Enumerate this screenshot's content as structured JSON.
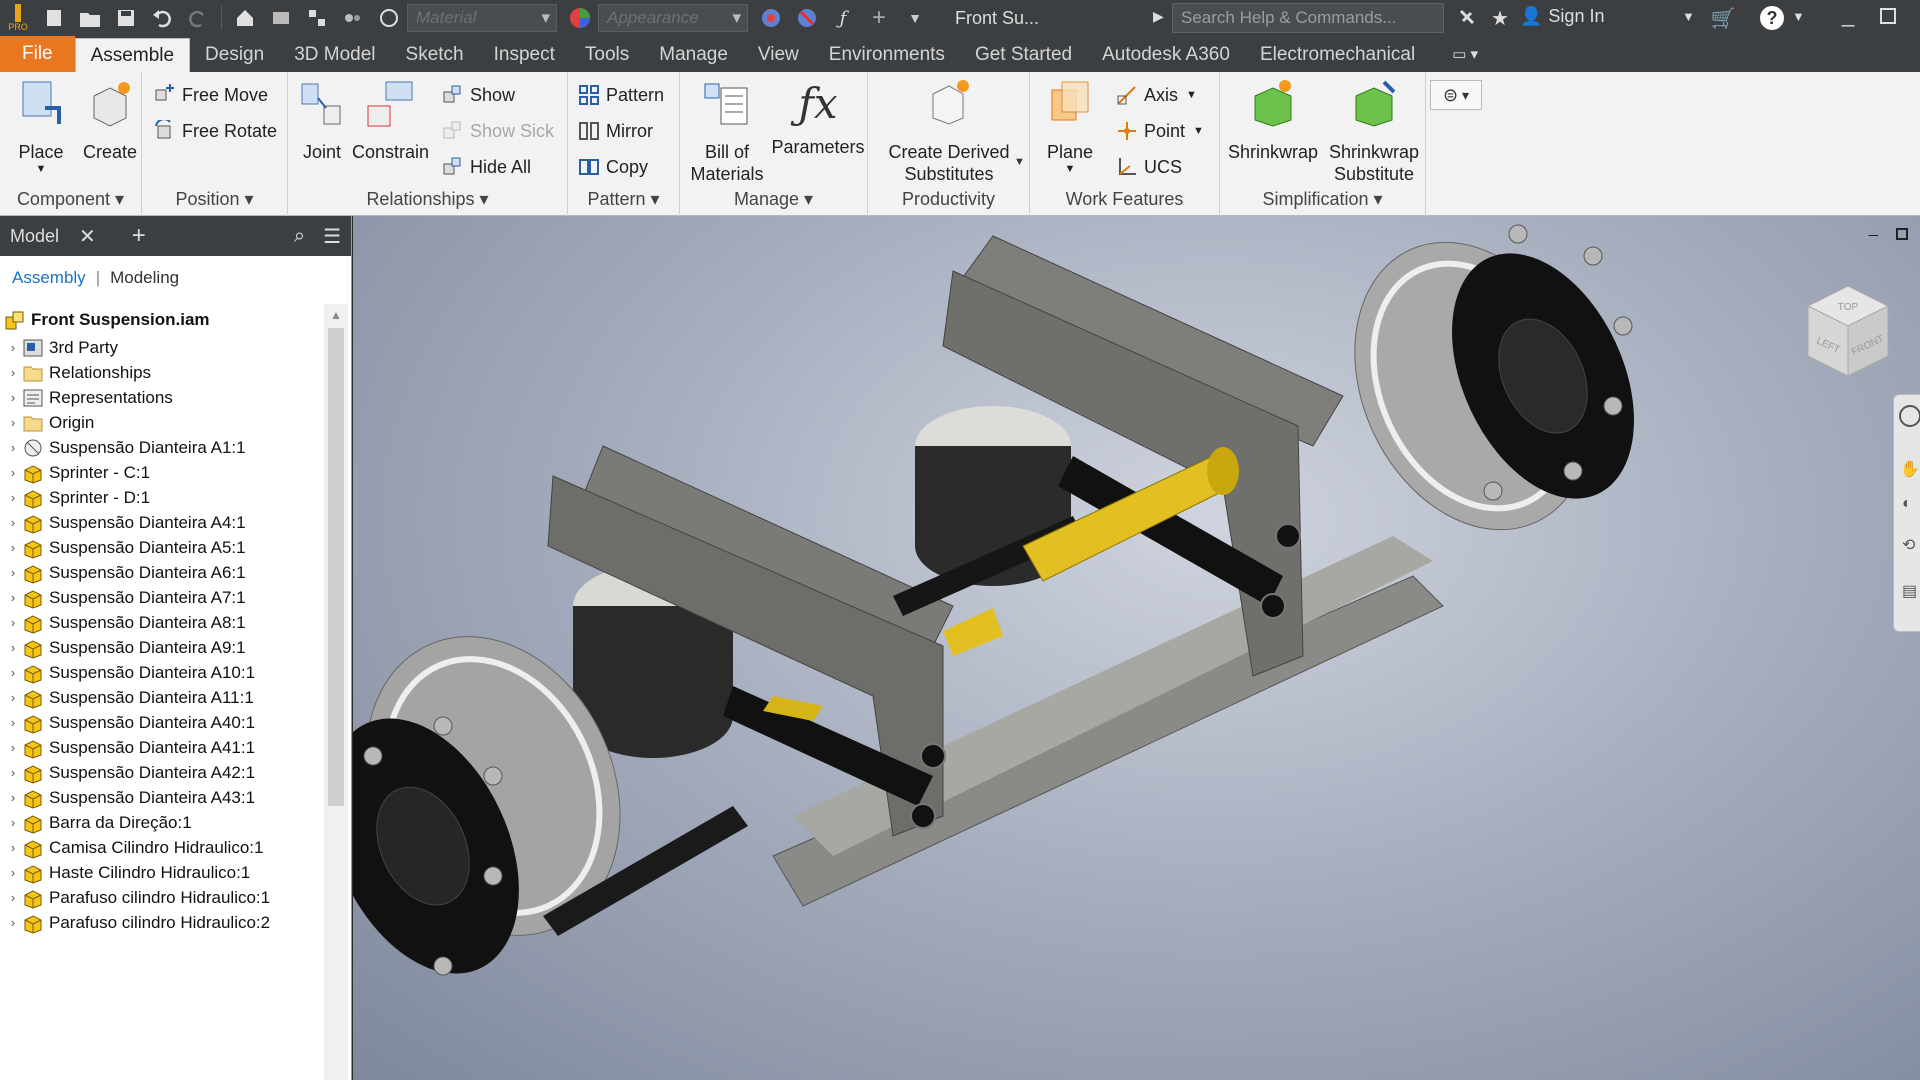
{
  "app": {
    "logo_text": "PRO",
    "document_title": "Front Su...",
    "material_placeholder": "Material",
    "appearance_placeholder": "Appearance",
    "search_placeholder": "Search Help & Commands...",
    "sign_in": "Sign In"
  },
  "tabs": [
    "File",
    "Assemble",
    "Design",
    "3D Model",
    "Sketch",
    "Inspect",
    "Tools",
    "Manage",
    "View",
    "Environments",
    "Get Started",
    "Autodesk A360",
    "Electromechanical"
  ],
  "ribbon": {
    "component": {
      "title": "Component",
      "place": "Place",
      "create": "Create"
    },
    "position": {
      "title": "Position",
      "free_move": "Free Move",
      "free_rotate": "Free Rotate"
    },
    "relationships": {
      "title": "Relationships",
      "joint": "Joint",
      "constrain": "Constrain",
      "show": "Show",
      "show_sick": "Show Sick",
      "hide_all": "Hide All"
    },
    "pattern": {
      "title": "Pattern",
      "pattern": "Pattern",
      "mirror": "Mirror",
      "copy": "Copy"
    },
    "manage": {
      "title": "Manage",
      "bom_line1": "Bill of",
      "bom_line2": "Materials",
      "parameters": "Parameters"
    },
    "productivity": {
      "title": "Productivity",
      "line1": "Create Derived",
      "line2": "Substitutes"
    },
    "work_features": {
      "title": "Work Features",
      "plane": "Plane",
      "axis": "Axis",
      "point": "Point",
      "ucs": "UCS"
    },
    "simplification": {
      "title": "Simplification",
      "shrinkwrap": "Shrinkwrap",
      "sub_line1": "Shrinkwrap",
      "sub_line2": "Substitute"
    }
  },
  "browser": {
    "tab_label": "Model",
    "add": "+",
    "view_assembly": "Assembly",
    "view_modeling": "Modeling",
    "root": "Front Suspension.iam",
    "items": [
      "3rd Party",
      "Relationships",
      "Representations",
      "Origin",
      "Suspensão Dianteira A1:1",
      "Sprinter - C:1",
      "Sprinter - D:1",
      "Suspensão Dianteira A4:1",
      "Suspensão Dianteira A5:1",
      "Suspensão Dianteira A6:1",
      "Suspensão Dianteira A7:1",
      "Suspensão Dianteira A8:1",
      "Suspensão Dianteira A9:1",
      "Suspensão Dianteira A10:1",
      "Suspensão Dianteira A11:1",
      "Suspensão Dianteira A40:1",
      "Suspensão Dianteira A41:1",
      "Suspensão Dianteira A42:1",
      "Suspensão Dianteira A43:1",
      "Barra da Direção:1",
      "Camisa Cilindro Hidraulico:1",
      "Haste Cilindro Hidraulico:1",
      "Parafuso cilindro Hidraulico:1",
      "Parafuso cilindro Hidraulico:2"
    ]
  },
  "viewcube": {
    "top": "TOP",
    "left": "LEFT",
    "front": "FRONT"
  },
  "colors": {
    "file_tab": "#e8771f",
    "accent_blue": "#1a73c8",
    "part_yellow": "#f5c518"
  }
}
